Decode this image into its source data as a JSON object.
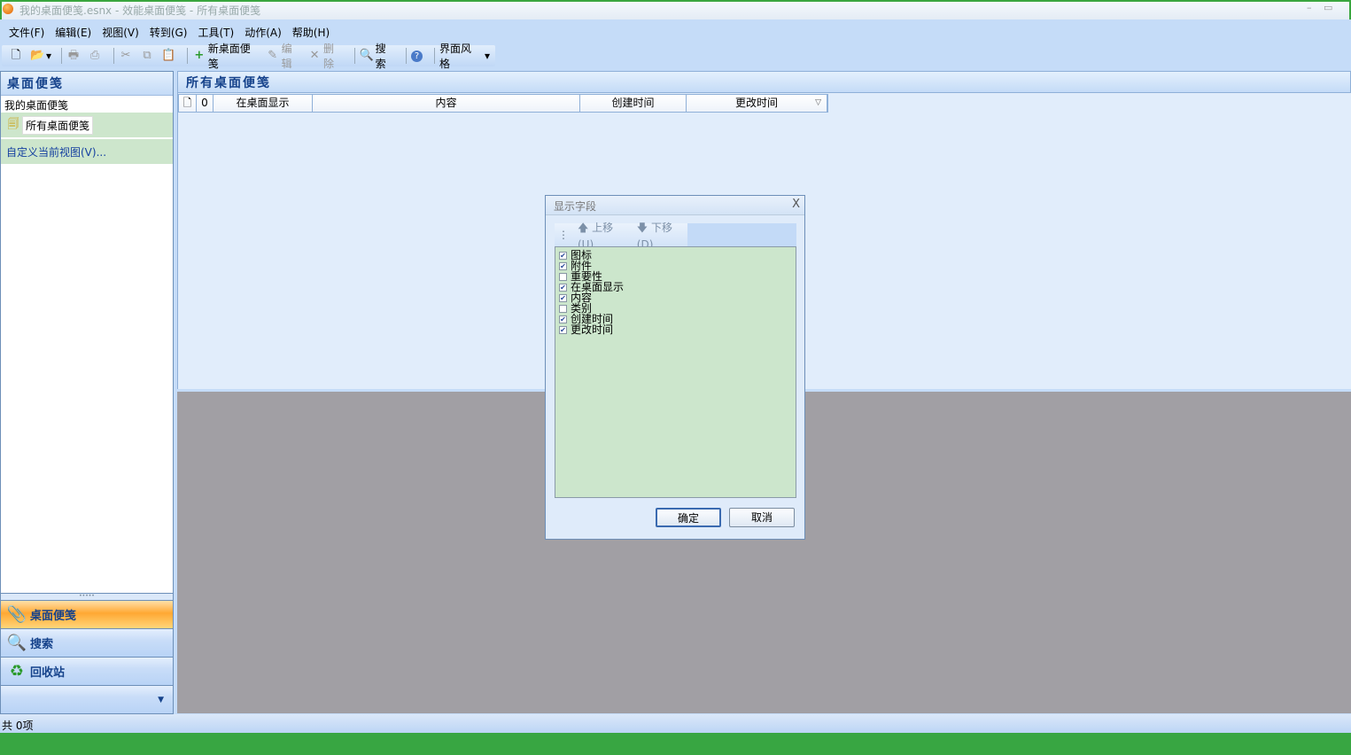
{
  "window": {
    "title": "我的桌面便笺.esnx - 效能桌面便笺 - 所有桌面便笺",
    "min": "–",
    "max": "▭"
  },
  "menu": [
    "文件(F)",
    "编辑(E)",
    "视图(V)",
    "转到(G)",
    "工具(T)",
    "动作(A)",
    "帮助(H)"
  ],
  "toolbar": {
    "new_note": "新桌面便笺",
    "edit": "编辑",
    "delete": "删除",
    "search": "搜索",
    "style": "界面风格"
  },
  "left": {
    "header": "桌面便笺",
    "group": "我的桌面便笺",
    "all_notes": "所有桌面便笺",
    "customize": "自定义当前视图(V)...",
    "nav": [
      {
        "label": "桌面便笺",
        "active": true
      },
      {
        "label": "搜索",
        "active": false
      },
      {
        "label": "回收站",
        "active": false
      }
    ]
  },
  "main": {
    "header": "所有桌面便笺",
    "columns": [
      "在桌面显示",
      "内容",
      "创建时间",
      "更改时间"
    ]
  },
  "dialog": {
    "title": "显示字段",
    "close": "X",
    "up": "上移(U)",
    "down": "下移(D)",
    "fields": [
      {
        "label": "图标",
        "checked": true
      },
      {
        "label": "附件",
        "checked": true
      },
      {
        "label": "重要性",
        "checked": false
      },
      {
        "label": "在桌面显示",
        "checked": true
      },
      {
        "label": "内容",
        "checked": true
      },
      {
        "label": "类别",
        "checked": false
      },
      {
        "label": "创建时间",
        "checked": true
      },
      {
        "label": "更改时间",
        "checked": true
      }
    ],
    "ok": "确定",
    "cancel": "取消"
  },
  "status": "共 0项"
}
